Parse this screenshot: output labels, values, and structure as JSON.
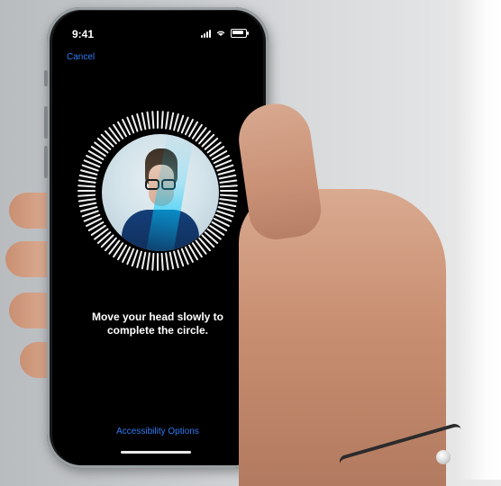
{
  "status_bar": {
    "time": "9:41",
    "icons": [
      "signal-bars-icon",
      "wifi-icon",
      "battery-icon"
    ]
  },
  "top_bar": {
    "cancel_label": "Cancel"
  },
  "face_id": {
    "instruction_line1": "Move your head slowly to",
    "instruction_line2": "complete the circle.",
    "icons": [
      "scan-ring-icon",
      "face-preview"
    ]
  },
  "bottom": {
    "accessibility_label": "Accessibility Options"
  },
  "colors": {
    "accent_blue": "#2f7cf6",
    "screen_bg": "#000000",
    "text_white": "#ffffff"
  }
}
